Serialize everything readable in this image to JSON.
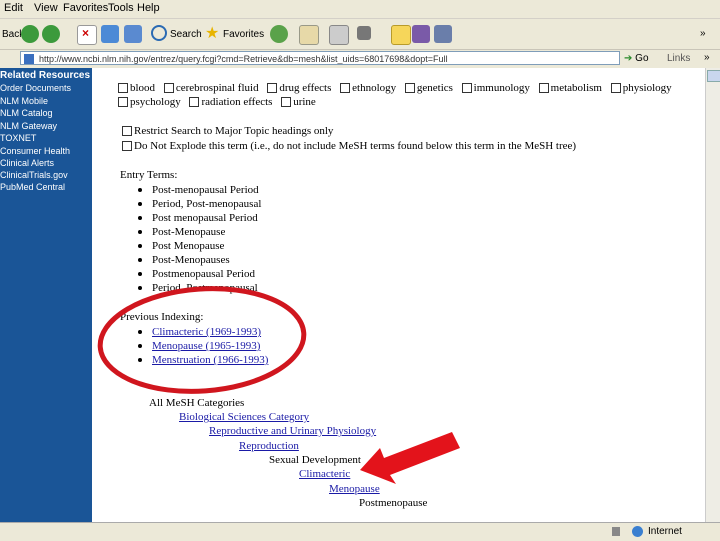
{
  "menubar": {
    "items": [
      "Edit",
      "View",
      "Favorites",
      "Tools",
      "Help"
    ]
  },
  "toolbar": {
    "back": "Back",
    "search": "Search",
    "favorites": "Favorites",
    "overflow": "»"
  },
  "address": {
    "url": "http://www.ncbi.nlm.nih.gov/entrez/query.fcgi?cmd=Retrieve&db=mesh&list_uids=68017698&dopt=Full",
    "go": "Go",
    "links": "Links",
    "overflow": "»"
  },
  "sidebar": {
    "items": [
      "Related Resources",
      "Order Documents",
      "NLM Mobile",
      "NLM Catalog",
      "NLM Gateway",
      "TOXNET",
      "Consumer Health",
      "Clinical Alerts",
      "ClinicalTrials.gov",
      "PubMed Central"
    ]
  },
  "subheadings": {
    "row1": [
      "blood",
      "cerebrospinal fluid",
      "drug effects",
      "ethnology",
      "genetics",
      "immunology",
      "metabolism",
      "physiology"
    ],
    "row2": [
      "psychology",
      "radiation effects",
      "urine"
    ]
  },
  "options": {
    "major": "Restrict Search to Major Topic headings only",
    "explode": "Do Not Explode this term (i.e., do not include MeSH terms found below this term in the MeSH tree)"
  },
  "entry_terms": {
    "heading": "Entry Terms:",
    "items": [
      "Post-menopausal Period",
      "Period, Post-menopausal",
      "Post menopausal Period",
      "Post-Menopause",
      "Post Menopause",
      "Post-Menopauses",
      "Postmenopausal Period",
      "Period, Postmenopausal"
    ]
  },
  "previous_indexing": {
    "heading": "Previous Indexing:",
    "items": [
      "Climacteric (1969-1993)",
      "Menopause (1965-1993)",
      "Menstruation (1966-1993)"
    ]
  },
  "tree": [
    {
      "label": "All MeSH Categories",
      "link": false
    },
    {
      "label": "Biological Sciences Category",
      "link": true
    },
    {
      "label": "Reproductive and Urinary Physiology",
      "link": true
    },
    {
      "label": "Reproduction",
      "link": true
    },
    {
      "label": "Sexual Development",
      "link": false
    },
    {
      "label": "Climacteric",
      "link": true
    },
    {
      "label": "Menopause",
      "link": true
    },
    {
      "label": "Postmenopause",
      "link": false
    }
  ],
  "status": {
    "zone": "Internet"
  },
  "colors": {
    "annotation_circle": "#d0161e",
    "annotation_arrow": "#e3131b",
    "sidebar": "#1a5597",
    "link": "#1a1aa6"
  }
}
